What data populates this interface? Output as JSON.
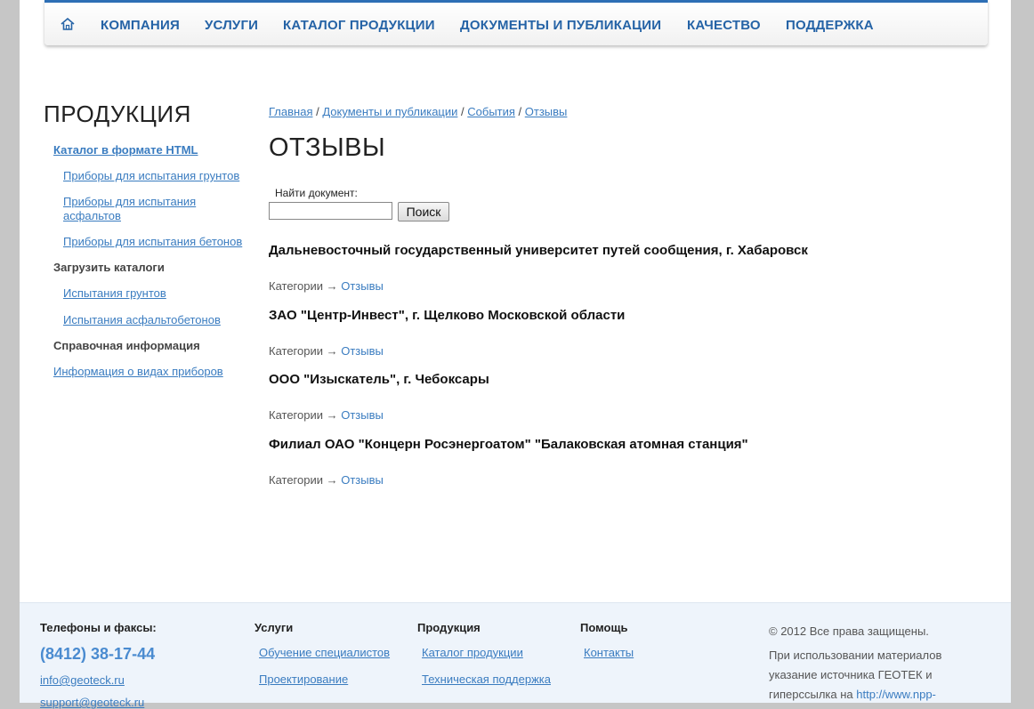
{
  "nav": {
    "items": [
      "КОМПАНИЯ",
      "УСЛУГИ",
      "КАТАЛОГ ПРОДУКЦИИ",
      "ДОКУМЕНТЫ И ПУБЛИКАЦИИ",
      "КАЧЕСТВО",
      "ПОДДЕРЖКА"
    ]
  },
  "sidebar": {
    "title": "ПРОДУКЦИЯ",
    "catalog_html": "Каталог в формате HTML",
    "soil_devices": "Приборы для испытания грунтов",
    "asphalt_devices_1": "Приборы для испытания",
    "asphalt_devices_2": "асфальтов",
    "concrete_devices": "Приборы для испытания бетонов",
    "download_head": "Загрузить каталоги",
    "soil_tests": "Испытания грунтов",
    "asphalt_tests": "Испытания асфальтобетонов",
    "reference_head": "Справочная информация",
    "device_info": "Информация о видах приборов"
  },
  "breadcrumb": {
    "home": "Главная",
    "docs": "Документы и публикации",
    "events": "События",
    "current": "Отзывы",
    "sep": " / "
  },
  "main": {
    "title": "ОТЗЫВЫ",
    "search_label": "Найти документ:",
    "search_value": "",
    "search_button": "Поиск",
    "category_prefix": "Категории → ",
    "category_link": "Отзывы",
    "docs": [
      "Дальневосточный государственный университет путей сообщения, г. Хабаровск",
      "ЗАО \"Центр-Инвест\", г. Щелково Московской области",
      "ООО \"Изыскатель\", г. Чебоксары",
      "Филиал ОАО \"Концерн Росэнергоатом\" \"Балаковская атомная станция\""
    ]
  },
  "footer": {
    "phones_head": "Телефоны и факсы:",
    "phone": "(8412) 38-17-44",
    "email1": "info@geoteck.ru",
    "email2": "support@geoteck.ru",
    "services_head": "Услуги",
    "service1": "Обучение специалистов",
    "service2": "Проектирование",
    "products_head": "Продукция",
    "product1": "Каталог продукции",
    "product2": "Техническая поддержка",
    "help_head": "Помощь",
    "contacts": "Контакты",
    "copyright": "© 2012 Все права защищены.",
    "notice1": "При использовании материалов",
    "notice2": "указание источника ГЕОТЕК и",
    "notice3": "гиперссылка на ",
    "notice_link": "http://www.npp-"
  },
  "colors": {
    "accent": "#2563a6",
    "link": "#3a7cc0",
    "footer_bg": "#eef4fb"
  }
}
